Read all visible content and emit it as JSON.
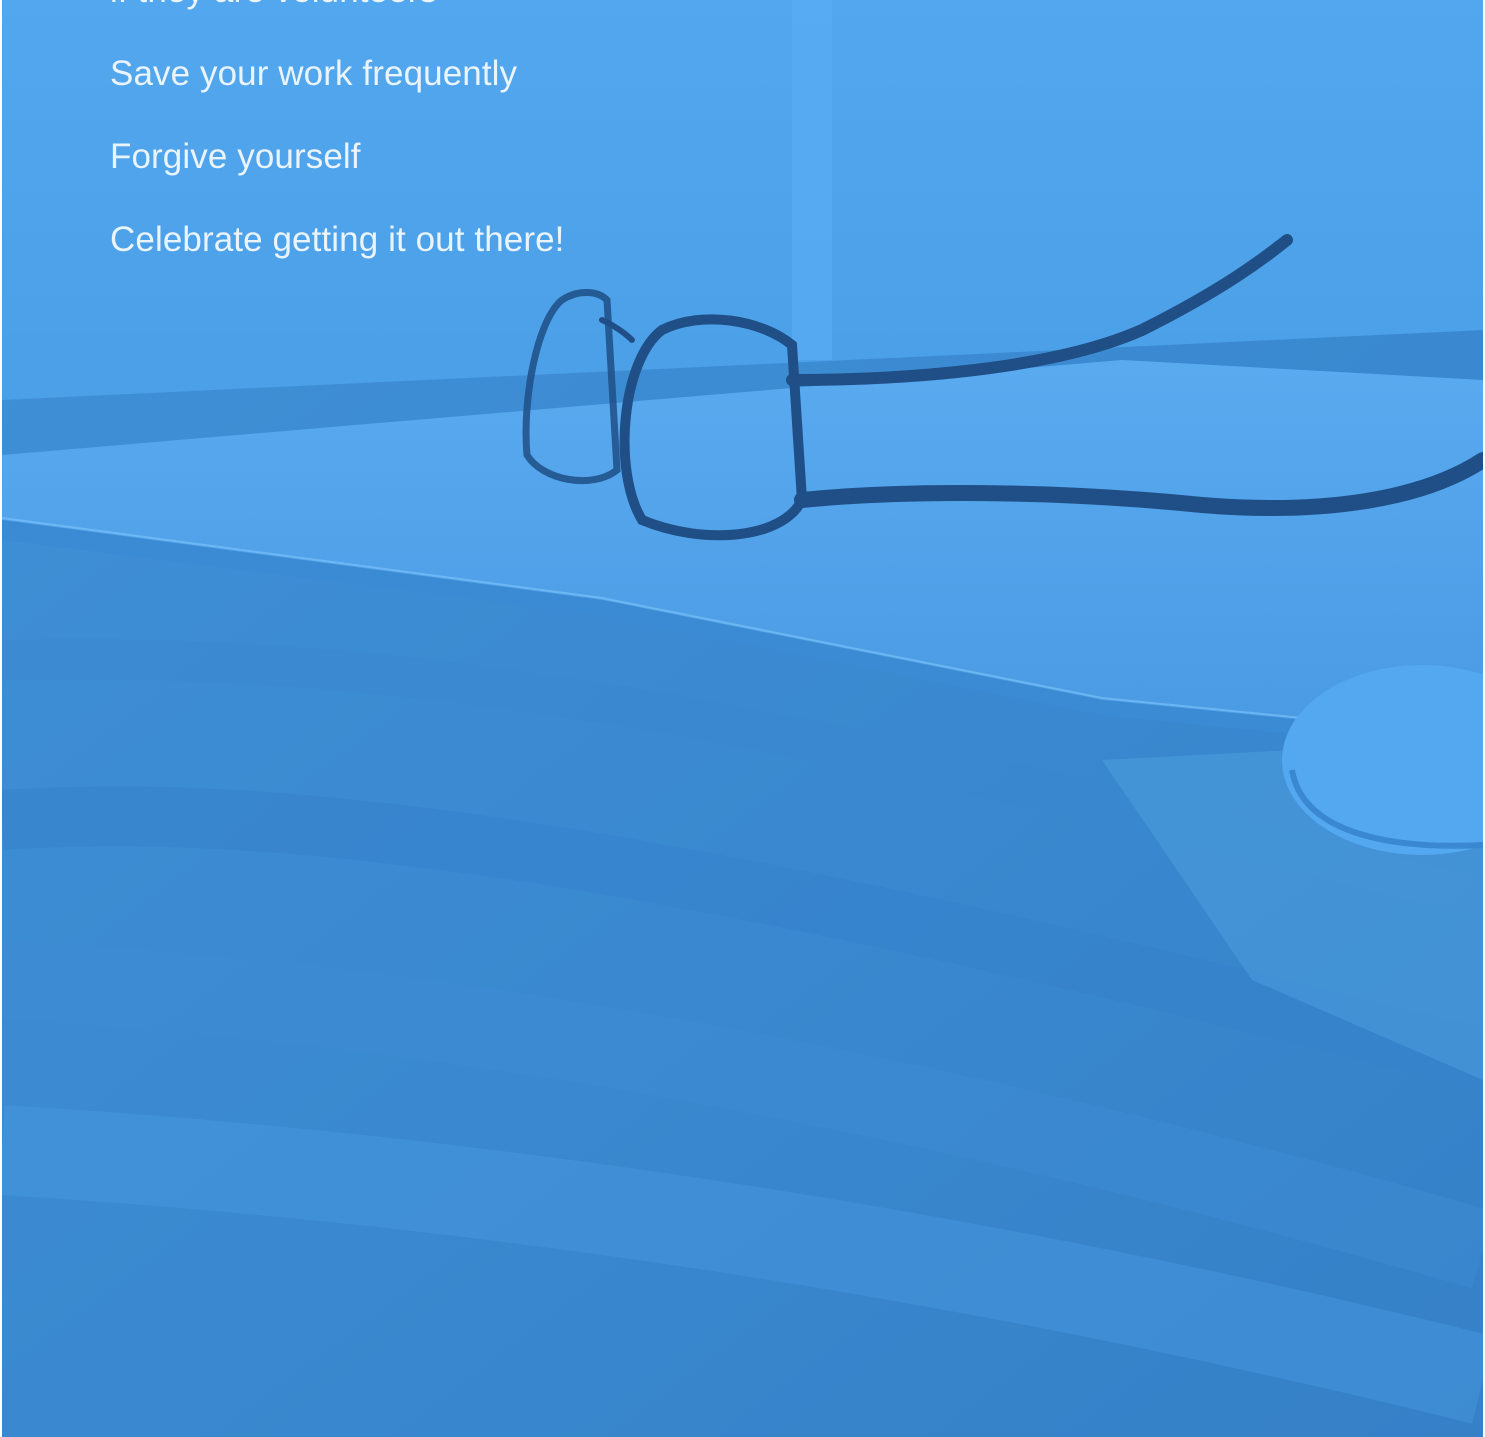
{
  "hero": {
    "overlay_color": "#4aa0e6",
    "tips": [
      "if they are volunteers",
      "Save your work frequently",
      "Forgive yourself",
      "Celebrate getting it out there!"
    ]
  }
}
